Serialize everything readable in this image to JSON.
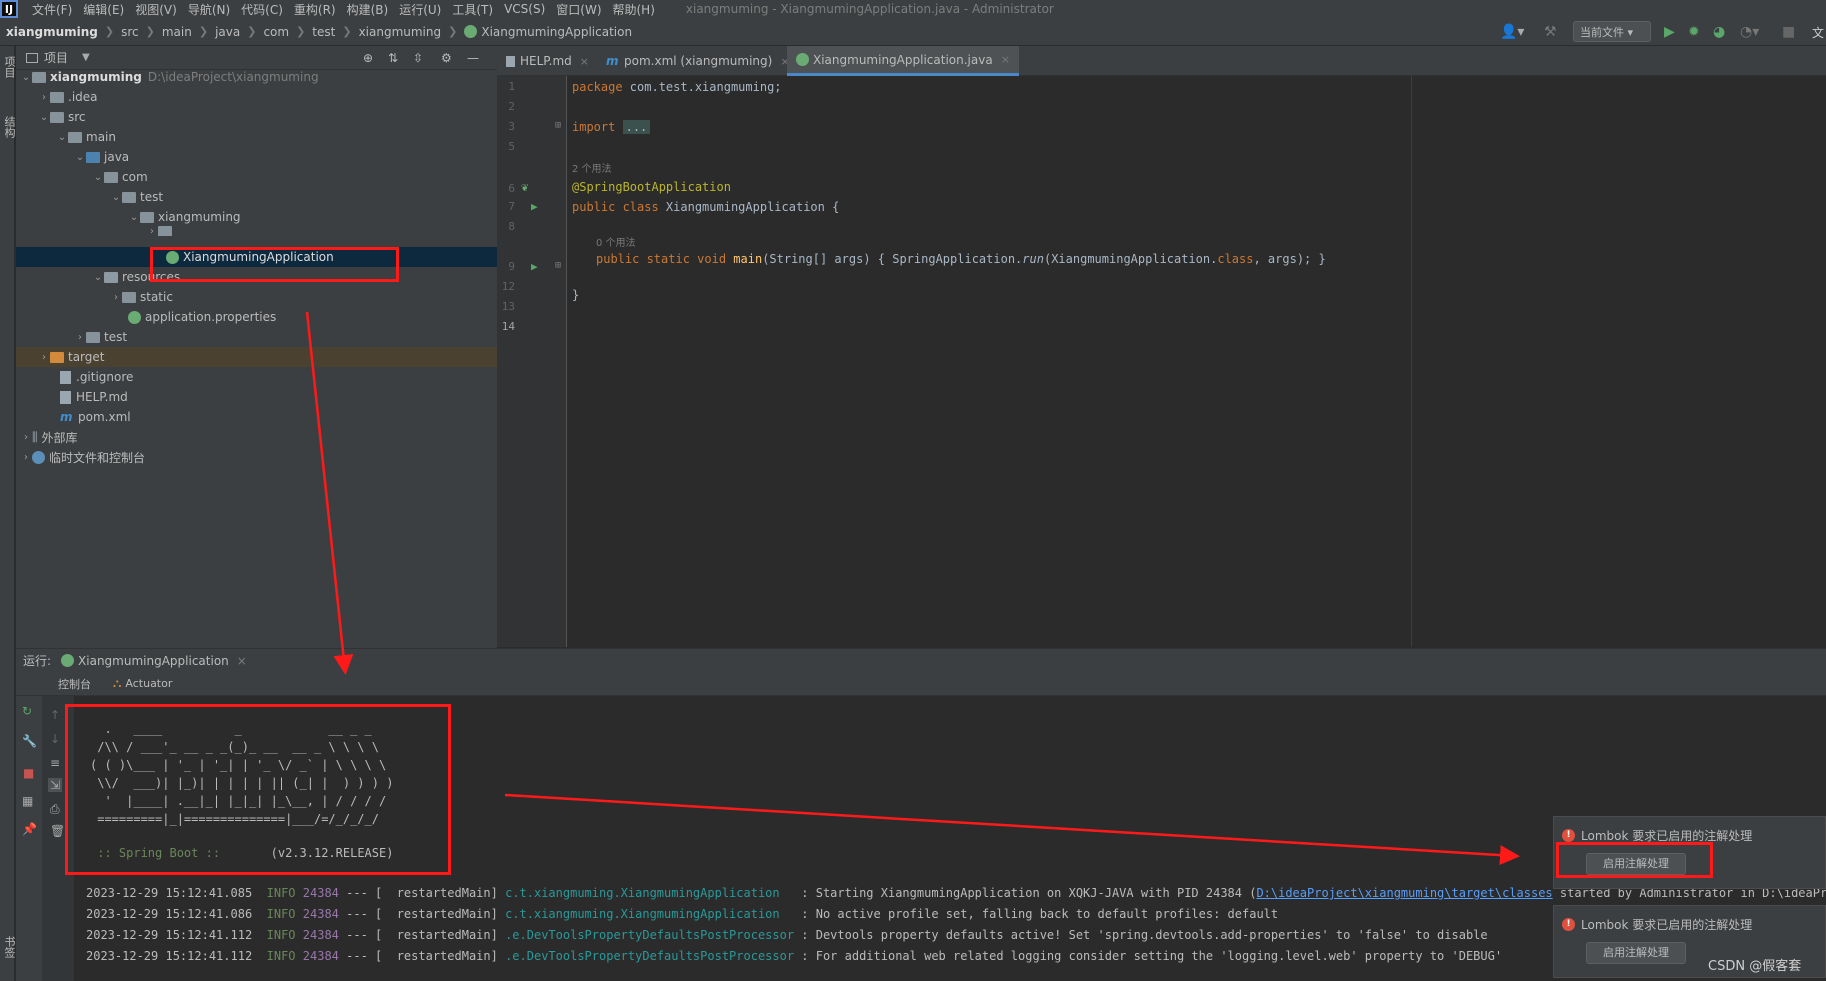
{
  "menubar": {
    "logo": "IJ",
    "items": [
      "文件(F)",
      "编辑(E)",
      "视图(V)",
      "导航(N)",
      "代码(C)",
      "重构(R)",
      "构建(B)",
      "运行(U)",
      "工具(T)",
      "VCS(S)",
      "窗口(W)",
      "帮助(H)"
    ],
    "window_title": "xiangmuming - XiangmumingApplication.java - Administrator"
  },
  "navbar": {
    "crumbs": [
      "xiangmuming",
      "src",
      "main",
      "java",
      "com",
      "test",
      "xiangmuming",
      "XiangmumingApplication"
    ],
    "run_config": "当前文件",
    "right_text": "文"
  },
  "left_strip": {
    "project_tab": "项目",
    "structure_tab": "结构",
    "bookmarks_tab": "书签"
  },
  "project": {
    "title": "项目",
    "root_name": "xiangmuming",
    "root_path": "D:\\ideaProject\\xiangmuming",
    "items": [
      ".idea",
      "src",
      "main",
      "java",
      "com",
      "test",
      "xiangmuming",
      "XiangmumingApplication",
      "resources",
      "static",
      "application.properties",
      "test",
      "target",
      ".gitignore",
      "HELP.md",
      "pom.xml",
      "外部库",
      "临时文件和控制台"
    ]
  },
  "editor": {
    "tabs": [
      "HELP.md",
      "pom.xml (xiangmuming)",
      "XiangmumingApplication.java"
    ],
    "line_numbers": [
      "1",
      "2",
      "3",
      "5",
      "6",
      "7",
      "8",
      "9",
      "12",
      "13",
      "14"
    ],
    "code": {
      "pkg_kw": "package",
      "pkg_name": " com.test.xiangmuming;",
      "import_kw": "import",
      "import_fold": "...",
      "usages1": "2 个用法",
      "annotation": "@SpringBootApplication",
      "class_kw": "public class",
      "class_name": " XiangmumingApplication {",
      "usages2": "0 个用法",
      "main_kw": "public static void",
      "main_name": "main",
      "main_params": "(String[] args)",
      "main_body_open": " { SpringApplication.",
      "main_run": "run",
      "main_body_mid": "(XiangmumingApplication.",
      "main_class_kw": "class",
      "main_body_end": ", args); }",
      "close_brace": "}"
    }
  },
  "run_panel": {
    "label": "运行:",
    "tab": "XiangmumingApplication",
    "console_tab": "控制台",
    "actuator_tab": "Actuator",
    "banner": [
      "  .   ____          _            __ _ _",
      " /\\\\ / ___'_ __ _ _(_)_ __  __ _ \\ \\ \\ \\",
      "( ( )\\___ | '_ | '_| | '_ \\/ _` | \\ \\ \\ \\",
      " \\\\/  ___)| |_)| | | | | || (_| |  ) ) ) )",
      "  '  |____| .__|_| |_|_| |_\\__, | / / / /",
      " =========|_|==============|___/=/_/_/_/"
    ],
    "banner_boot": " :: Spring Boot ::",
    "banner_version": "       (v2.3.12.RELEASE)",
    "logs": [
      {
        "time": "2023-12-29 15:12:41.085",
        "level": "INFO",
        "pid": "24384",
        "thread": "--- [  restartedMain]",
        "logger": "c.t.xiangmuming.XiangmumingApplication  ",
        "msg": " : Starting XiangmumingApplication on XQKJ-JAVA with PID 24384 (",
        "link": "D:\\ideaProject\\xiangmuming\\target\\classes",
        "tail": " started by Administrator in D:\\ideaProject\\xi"
      },
      {
        "time": "2023-12-29 15:12:41.086",
        "level": "INFO",
        "pid": "24384",
        "thread": "--- [  restartedMain]",
        "logger": "c.t.xiangmuming.XiangmumingApplication  ",
        "msg": " : No active profile set, falling back to default profiles: default",
        "link": "",
        "tail": ""
      },
      {
        "time": "2023-12-29 15:12:41.112",
        "level": "INFO",
        "pid": "24384",
        "thread": "--- [  restartedMain]",
        "logger": ".e.DevToolsPropertyDefaultsPostProcessor",
        "msg": " : Devtools property defaults active! Set 'spring.devtools.add-properties' to 'false' to disable",
        "link": "",
        "tail": ""
      },
      {
        "time": "2023-12-29 15:12:41.112",
        "level": "INFO",
        "pid": "24384",
        "thread": "--- [  restartedMain]",
        "logger": ".e.DevToolsPropertyDefaultsPostProcessor",
        "msg": " : For additional web related logging consider setting the 'logging.level.web' property to 'DEBUG'",
        "link": "",
        "tail": ""
      }
    ]
  },
  "notifications": [
    {
      "title": "Lombok 要求已启用的注解处理",
      "button": "启用注解处理"
    },
    {
      "title": "Lombok 要求已启用的注解处理",
      "button": "启用注解处理"
    }
  ],
  "watermark": "CSDN @假客套",
  "colors": {
    "annotation_red": "#ff1a1a",
    "selection": "#0d293e",
    "accent": "#4a88c7"
  }
}
